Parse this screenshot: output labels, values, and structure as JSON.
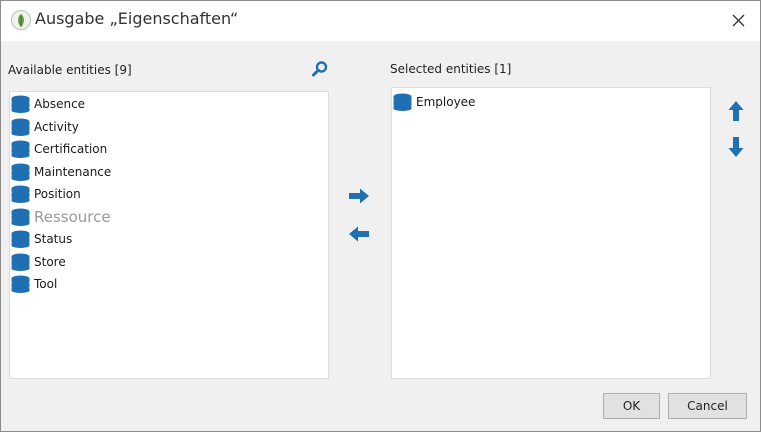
{
  "window": {
    "title": "Ausgabe „Eigenschaften“"
  },
  "available": {
    "header": "Available entities [9]",
    "items": [
      {
        "label": "Absence"
      },
      {
        "label": "Activity"
      },
      {
        "label": "Certification"
      },
      {
        "label": "Maintenance"
      },
      {
        "label": "Position"
      },
      {
        "label": "Ressource"
      },
      {
        "label": "Status"
      },
      {
        "label": "Store"
      },
      {
        "label": "Tool"
      }
    ]
  },
  "selected": {
    "header": "Selected entities [1]",
    "items": [
      {
        "label": "Employee"
      }
    ]
  },
  "footer": {
    "ok_label": "OK",
    "cancel_label": "Cancel"
  },
  "colors": {
    "accent": "#1f6fb2"
  },
  "icons": {
    "app": "leaf-logo-icon",
    "close": "close-icon",
    "search": "search-icon",
    "entity": "database-icon",
    "add": "arrow-right-icon",
    "remove": "arrow-left-icon",
    "up": "arrow-up-icon",
    "down": "arrow-down-icon"
  }
}
